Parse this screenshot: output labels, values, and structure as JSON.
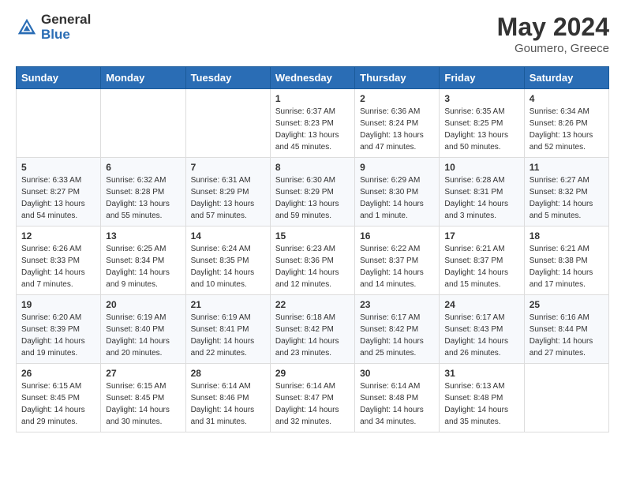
{
  "header": {
    "logo_general": "General",
    "logo_blue": "Blue",
    "title": "May 2024",
    "location": "Goumero, Greece"
  },
  "weekdays": [
    "Sunday",
    "Monday",
    "Tuesday",
    "Wednesday",
    "Thursday",
    "Friday",
    "Saturday"
  ],
  "weeks": [
    [
      {
        "day": "",
        "sunrise": "",
        "sunset": "",
        "daylight": ""
      },
      {
        "day": "",
        "sunrise": "",
        "sunset": "",
        "daylight": ""
      },
      {
        "day": "",
        "sunrise": "",
        "sunset": "",
        "daylight": ""
      },
      {
        "day": "1",
        "sunrise": "Sunrise: 6:37 AM",
        "sunset": "Sunset: 8:23 PM",
        "daylight": "Daylight: 13 hours and 45 minutes."
      },
      {
        "day": "2",
        "sunrise": "Sunrise: 6:36 AM",
        "sunset": "Sunset: 8:24 PM",
        "daylight": "Daylight: 13 hours and 47 minutes."
      },
      {
        "day": "3",
        "sunrise": "Sunrise: 6:35 AM",
        "sunset": "Sunset: 8:25 PM",
        "daylight": "Daylight: 13 hours and 50 minutes."
      },
      {
        "day": "4",
        "sunrise": "Sunrise: 6:34 AM",
        "sunset": "Sunset: 8:26 PM",
        "daylight": "Daylight: 13 hours and 52 minutes."
      }
    ],
    [
      {
        "day": "5",
        "sunrise": "Sunrise: 6:33 AM",
        "sunset": "Sunset: 8:27 PM",
        "daylight": "Daylight: 13 hours and 54 minutes."
      },
      {
        "day": "6",
        "sunrise": "Sunrise: 6:32 AM",
        "sunset": "Sunset: 8:28 PM",
        "daylight": "Daylight: 13 hours and 55 minutes."
      },
      {
        "day": "7",
        "sunrise": "Sunrise: 6:31 AM",
        "sunset": "Sunset: 8:29 PM",
        "daylight": "Daylight: 13 hours and 57 minutes."
      },
      {
        "day": "8",
        "sunrise": "Sunrise: 6:30 AM",
        "sunset": "Sunset: 8:29 PM",
        "daylight": "Daylight: 13 hours and 59 minutes."
      },
      {
        "day": "9",
        "sunrise": "Sunrise: 6:29 AM",
        "sunset": "Sunset: 8:30 PM",
        "daylight": "Daylight: 14 hours and 1 minute."
      },
      {
        "day": "10",
        "sunrise": "Sunrise: 6:28 AM",
        "sunset": "Sunset: 8:31 PM",
        "daylight": "Daylight: 14 hours and 3 minutes."
      },
      {
        "day": "11",
        "sunrise": "Sunrise: 6:27 AM",
        "sunset": "Sunset: 8:32 PM",
        "daylight": "Daylight: 14 hours and 5 minutes."
      }
    ],
    [
      {
        "day": "12",
        "sunrise": "Sunrise: 6:26 AM",
        "sunset": "Sunset: 8:33 PM",
        "daylight": "Daylight: 14 hours and 7 minutes."
      },
      {
        "day": "13",
        "sunrise": "Sunrise: 6:25 AM",
        "sunset": "Sunset: 8:34 PM",
        "daylight": "Daylight: 14 hours and 9 minutes."
      },
      {
        "day": "14",
        "sunrise": "Sunrise: 6:24 AM",
        "sunset": "Sunset: 8:35 PM",
        "daylight": "Daylight: 14 hours and 10 minutes."
      },
      {
        "day": "15",
        "sunrise": "Sunrise: 6:23 AM",
        "sunset": "Sunset: 8:36 PM",
        "daylight": "Daylight: 14 hours and 12 minutes."
      },
      {
        "day": "16",
        "sunrise": "Sunrise: 6:22 AM",
        "sunset": "Sunset: 8:37 PM",
        "daylight": "Daylight: 14 hours and 14 minutes."
      },
      {
        "day": "17",
        "sunrise": "Sunrise: 6:21 AM",
        "sunset": "Sunset: 8:37 PM",
        "daylight": "Daylight: 14 hours and 15 minutes."
      },
      {
        "day": "18",
        "sunrise": "Sunrise: 6:21 AM",
        "sunset": "Sunset: 8:38 PM",
        "daylight": "Daylight: 14 hours and 17 minutes."
      }
    ],
    [
      {
        "day": "19",
        "sunrise": "Sunrise: 6:20 AM",
        "sunset": "Sunset: 8:39 PM",
        "daylight": "Daylight: 14 hours and 19 minutes."
      },
      {
        "day": "20",
        "sunrise": "Sunrise: 6:19 AM",
        "sunset": "Sunset: 8:40 PM",
        "daylight": "Daylight: 14 hours and 20 minutes."
      },
      {
        "day": "21",
        "sunrise": "Sunrise: 6:19 AM",
        "sunset": "Sunset: 8:41 PM",
        "daylight": "Daylight: 14 hours and 22 minutes."
      },
      {
        "day": "22",
        "sunrise": "Sunrise: 6:18 AM",
        "sunset": "Sunset: 8:42 PM",
        "daylight": "Daylight: 14 hours and 23 minutes."
      },
      {
        "day": "23",
        "sunrise": "Sunrise: 6:17 AM",
        "sunset": "Sunset: 8:42 PM",
        "daylight": "Daylight: 14 hours and 25 minutes."
      },
      {
        "day": "24",
        "sunrise": "Sunrise: 6:17 AM",
        "sunset": "Sunset: 8:43 PM",
        "daylight": "Daylight: 14 hours and 26 minutes."
      },
      {
        "day": "25",
        "sunrise": "Sunrise: 6:16 AM",
        "sunset": "Sunset: 8:44 PM",
        "daylight": "Daylight: 14 hours and 27 minutes."
      }
    ],
    [
      {
        "day": "26",
        "sunrise": "Sunrise: 6:15 AM",
        "sunset": "Sunset: 8:45 PM",
        "daylight": "Daylight: 14 hours and 29 minutes."
      },
      {
        "day": "27",
        "sunrise": "Sunrise: 6:15 AM",
        "sunset": "Sunset: 8:45 PM",
        "daylight": "Daylight: 14 hours and 30 minutes."
      },
      {
        "day": "28",
        "sunrise": "Sunrise: 6:14 AM",
        "sunset": "Sunset: 8:46 PM",
        "daylight": "Daylight: 14 hours and 31 minutes."
      },
      {
        "day": "29",
        "sunrise": "Sunrise: 6:14 AM",
        "sunset": "Sunset: 8:47 PM",
        "daylight": "Daylight: 14 hours and 32 minutes."
      },
      {
        "day": "30",
        "sunrise": "Sunrise: 6:14 AM",
        "sunset": "Sunset: 8:48 PM",
        "daylight": "Daylight: 14 hours and 34 minutes."
      },
      {
        "day": "31",
        "sunrise": "Sunrise: 6:13 AM",
        "sunset": "Sunset: 8:48 PM",
        "daylight": "Daylight: 14 hours and 35 minutes."
      },
      {
        "day": "",
        "sunrise": "",
        "sunset": "",
        "daylight": ""
      }
    ]
  ]
}
